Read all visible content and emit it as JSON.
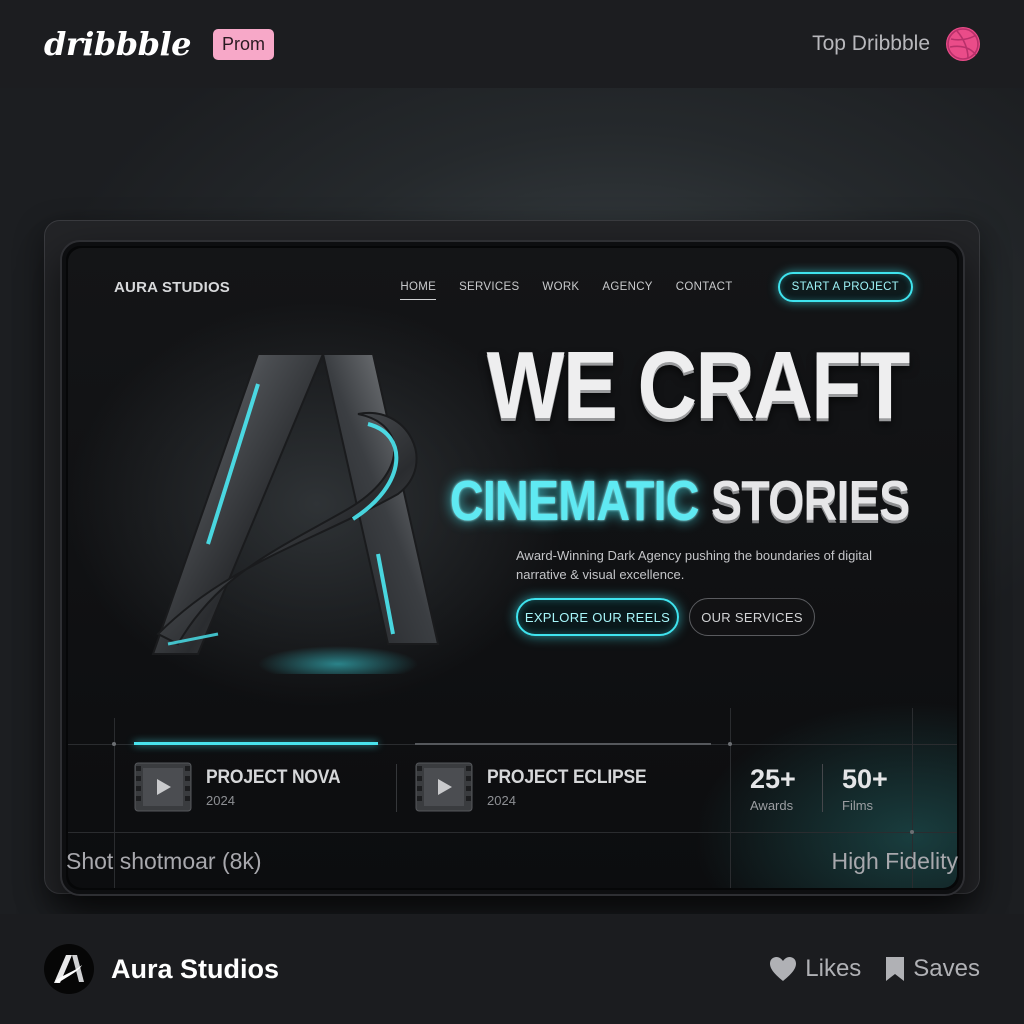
{
  "topbar": {
    "logo": "dribbble",
    "badge": "Prom",
    "right_label": "Top Dribbble",
    "icon": "dribbble-ball-icon"
  },
  "screen": {
    "brand": "AURA STUDIOS",
    "nav": [
      {
        "label": "HOME",
        "active": true
      },
      {
        "label": "SERVICES",
        "active": false
      },
      {
        "label": "WORK",
        "active": false
      },
      {
        "label": "AGENCY",
        "active": false
      },
      {
        "label": "CONTACT",
        "active": false
      }
    ],
    "cta": "START A PROJECT",
    "headline": "WE CRAFT",
    "subhead_accent": "CINEMATIC",
    "subhead_rest": "STORIES",
    "description": "Award-Winning Dark Agency pushing the boundaries of digital narrative & visual excellence.",
    "primary_button": "EXPLORE OUR REELS",
    "secondary_button": "OUR SERVICES",
    "projects": [
      {
        "name": "PROJECT NOVA",
        "year": "2024"
      },
      {
        "name": "PROJECT ECLIPSE",
        "year": "2024"
      }
    ],
    "stats": [
      {
        "value": "25+",
        "label": "Awards"
      },
      {
        "value": "50+",
        "label": "Films"
      }
    ]
  },
  "captions": {
    "left": "Shot shotmoar (8k)",
    "right": "High Fidelity"
  },
  "footer": {
    "studio": "Aura Studios",
    "likes": "Likes",
    "saves": "Saves"
  },
  "colors": {
    "accent": "#49e4ee",
    "dribbble_pink": "#ea4c89",
    "badge_pink": "#f7a8c8"
  }
}
